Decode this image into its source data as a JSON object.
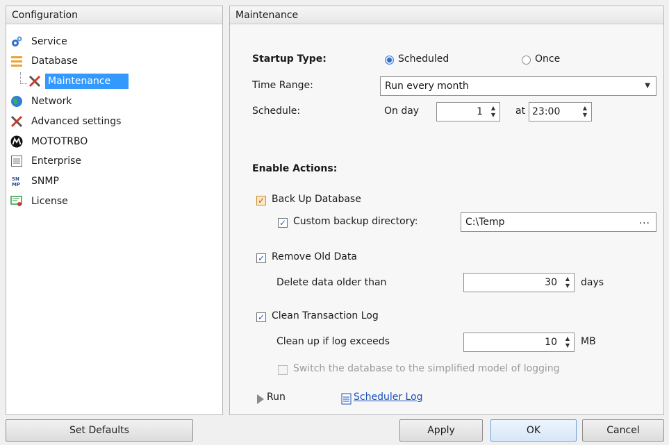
{
  "left_panel": {
    "title": "Configuration",
    "items": [
      {
        "label": "Service",
        "icon": "gears-icon"
      },
      {
        "label": "Database",
        "icon": "database-icon"
      },
      {
        "label": "Maintenance",
        "icon": "tools-icon",
        "selected": true
      },
      {
        "label": "Network",
        "icon": "globe-icon"
      },
      {
        "label": "Advanced settings",
        "icon": "tools-icon"
      },
      {
        "label": "MOTOTRBO",
        "icon": "motorola-icon"
      },
      {
        "label": "Enterprise",
        "icon": "enterprise-icon"
      },
      {
        "label": "SNMP",
        "icon": "snmp-icon"
      },
      {
        "label": "License",
        "icon": "license-icon"
      }
    ]
  },
  "right_panel": {
    "title": "Maintenance",
    "startup_type_label": "Startup Type:",
    "scheduled_label": "Scheduled",
    "once_label": "Once",
    "time_range_label": "Time Range:",
    "time_range_value": "Run every month",
    "schedule_label": "Schedule:",
    "on_day_label": "On day",
    "on_day_value": "1",
    "at_label": "at",
    "at_value": "23:00",
    "enable_actions_label": "Enable Actions:",
    "backup_label": "Back Up Database",
    "custom_backup_label": "Custom backup directory:",
    "custom_backup_value": "C:\\Temp",
    "ellipsis": "...",
    "remove_old_label": "Remove Old Data",
    "delete_older_label": "Delete data older than",
    "delete_older_value": "30",
    "days_label": "days",
    "clean_log_label": "Clean Transaction Log",
    "clean_up_label": "Clean up if log exceeds",
    "clean_up_value": "10",
    "mb_label": "MB",
    "simplified_label": "Switch the database to the simplified model of logging",
    "run_label": "Run",
    "scheduler_log_label": "Scheduler Log"
  },
  "buttons": {
    "set_defaults": "Set Defaults",
    "apply": "Apply",
    "ok": "OK",
    "cancel": "Cancel"
  },
  "colors": {
    "selection": "#3399ff",
    "link": "#1a4fb8",
    "accent_orange": "#f0a030"
  }
}
